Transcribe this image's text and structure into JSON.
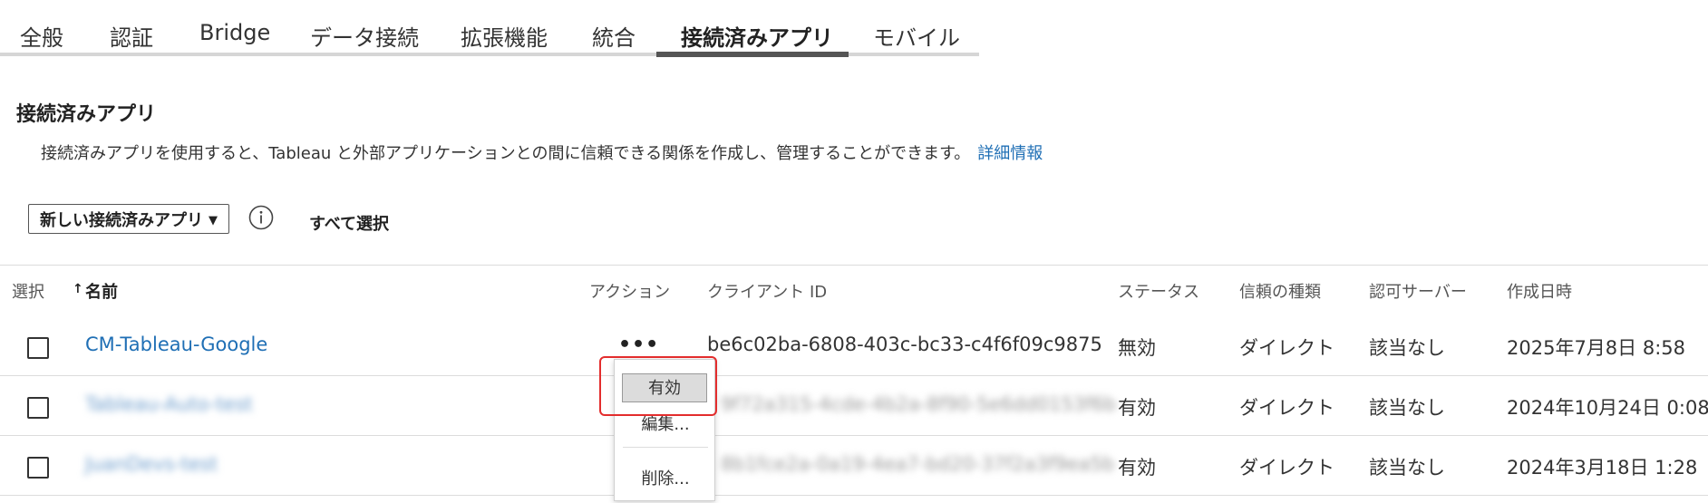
{
  "tabs": [
    {
      "label": "全般"
    },
    {
      "label": "認証"
    },
    {
      "label": "Bridge"
    },
    {
      "label": "データ接続"
    },
    {
      "label": "拡張機能"
    },
    {
      "label": "統合"
    },
    {
      "label": "接続済みアプリ",
      "active": true
    },
    {
      "label": "モバイル"
    }
  ],
  "section": {
    "title": "接続済みアプリ",
    "description": "接続済みアプリを使用すると、Tableau と外部アプリケーションとの間に信頼できる関係を作成し、管理することができます。",
    "learn_more": "詳細情報"
  },
  "toolbar": {
    "new_app_label": "新しい接続済みアプリ",
    "caret": "▼",
    "info_icon": "info-circle-icon",
    "select_all_label": "すべて選択"
  },
  "table": {
    "headers": {
      "select": "選択",
      "sort_arrow": "↑",
      "name": "名前",
      "actions": "アクション",
      "client_id": "クライアント ID",
      "status": "ステータス",
      "trust_type": "信頼の種類",
      "auth_server": "認可サーバー",
      "created": "作成日時"
    },
    "rows": [
      {
        "name": "CM-Tableau-Google",
        "actions": "•••",
        "client_id": "be6c02ba-6808-403c-bc33-c4f6f09c9875",
        "status": "無効",
        "trust_type": "ダイレクト",
        "auth_server": "該当なし",
        "created": "2025年7月8日 8:58",
        "checked": false
      },
      {
        "name": "Tableau-Auto-test",
        "client_id": "9f72a315-4cde-4b2a-8f90-5e6dd0153f6b",
        "status": "有効",
        "trust_type": "ダイレクト",
        "auth_server": "該当なし",
        "created": "2024年10月24日 0:08",
        "checked": false,
        "redacted": true
      },
      {
        "name": "JuanDevs-test",
        "client_id": "8b1fce2a-0a19-4ea7-bd20-37f2a3f9ea5b",
        "status": "有効",
        "trust_type": "ダイレクト",
        "auth_server": "該当なし",
        "created": "2024年3月18日 1:28",
        "checked": false,
        "redacted": true
      }
    ]
  },
  "action_menu": {
    "items": [
      {
        "label": "有効",
        "highlighted": true
      },
      {
        "label": "編集..."
      },
      {
        "label": "削除..."
      }
    ]
  },
  "colors": {
    "link": "#1f6fb5",
    "highlight_border": "#e32d2d",
    "active_tab_underline": "#555555"
  }
}
